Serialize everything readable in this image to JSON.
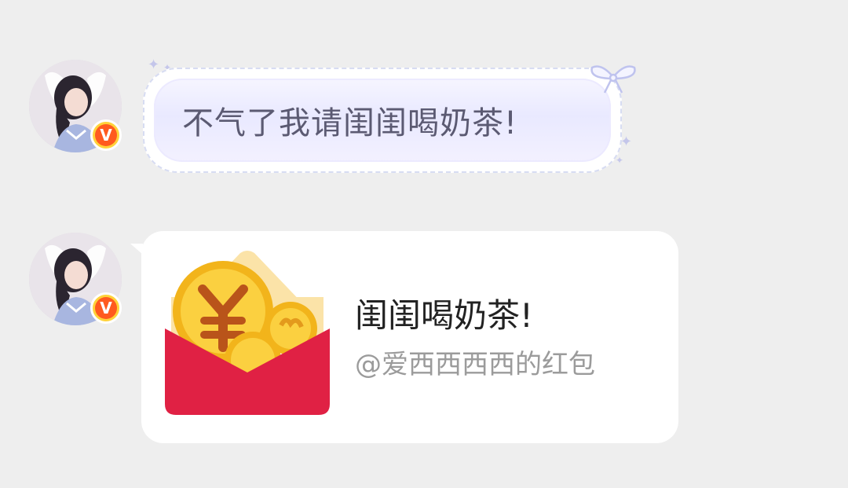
{
  "messages": [
    {
      "type": "text",
      "text": "不气了我请闺闺喝奶茶!",
      "avatar_badge": "V"
    },
    {
      "type": "red_packet",
      "title": "闺闺喝奶茶!",
      "subtitle": "@爱西西西西的红包",
      "avatar_badge": "V"
    }
  ],
  "icons": {
    "verified": "verified-badge-icon",
    "red_packet": "red-packet-icon",
    "yuan": "yuan-coin-icon",
    "bow": "ribbon-bow-icon",
    "sparkle": "sparkle-icon"
  },
  "colors": {
    "background": "#eeeeee",
    "packet_red": "#e02144",
    "coin_gold": "#f7c42a",
    "badge_orange": "#ff5a1f",
    "badge_yellow": "#ffd23a",
    "bubble_text": "#5b5a72",
    "subtitle_gray": "#9b9b9b"
  }
}
